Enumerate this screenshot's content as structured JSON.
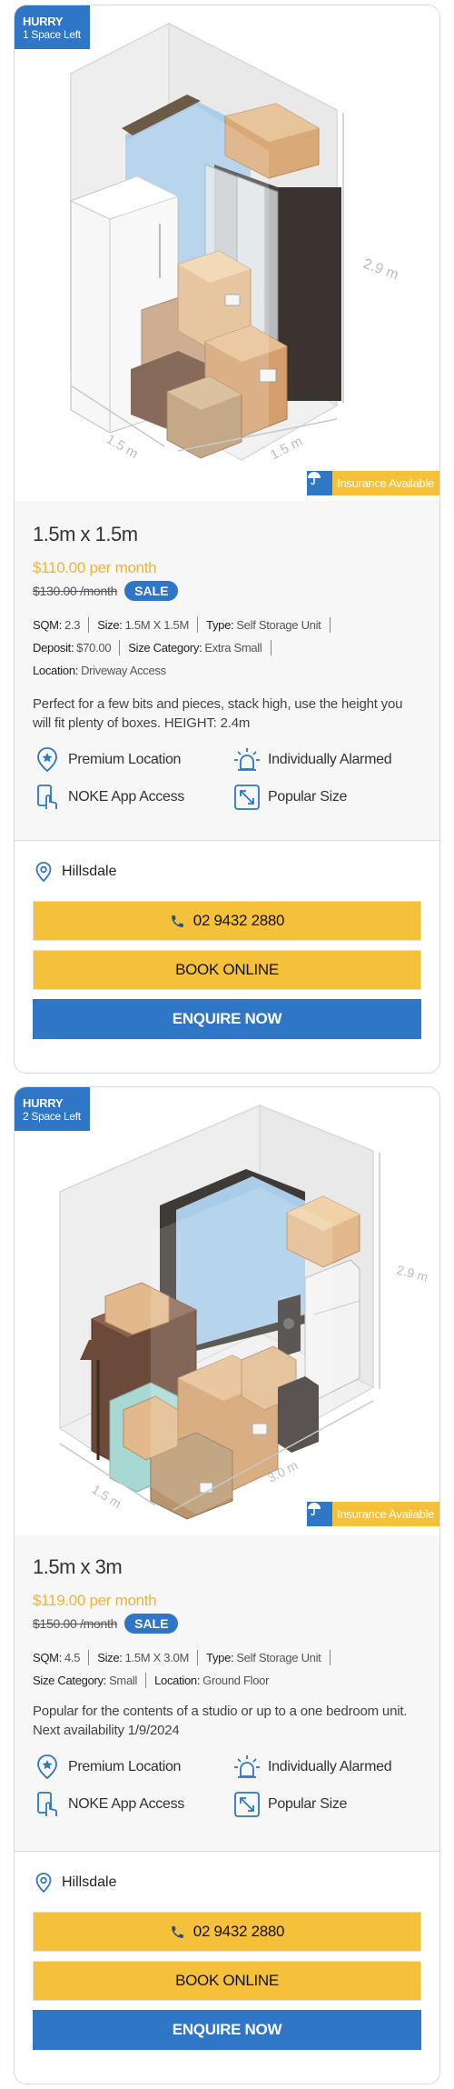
{
  "brand": {
    "colors": {
      "primary_blue": "#2f76c6",
      "accent_yellow": "#f5c13a",
      "price_orange": "#f2b431"
    }
  },
  "units": [
    {
      "hurry_title": "HURRY",
      "hurry_subtitle": "1 Space Left",
      "dim_side": "1.5 m",
      "dim_front": "1.5 m",
      "dim_height": "2.9 m",
      "insurance_label": "Insurance Available",
      "size_title": "1.5m x 1.5m",
      "price": "$110.00 per month",
      "was_price": "$130.00 /month",
      "sale_badge": "SALE",
      "specs": {
        "sqm_label": "SQM:",
        "sqm_value": "2.3",
        "size_label": "Size:",
        "size_value": "1.5M X 1.5M",
        "type_label": "Type:",
        "type_value": "Self Storage Unit",
        "deposit_label": "Deposit:",
        "deposit_value": "$70.00",
        "category_label": "Size Category:",
        "category_value": "Extra Small",
        "location_label": "Location:",
        "location_value": "Driveway Access"
      },
      "description": "Perfect for a few bits and pieces, stack high, use the height you will fit plenty of boxes. HEIGHT: 2.4m",
      "features": [
        "Premium Location",
        "Individually Alarmed",
        "NOKE App Access",
        "Popular Size"
      ],
      "location": "Hillsdale",
      "phone_button": "02 9432 2880",
      "book_button": "BOOK ONLINE",
      "enquire_button": "ENQUIRE NOW"
    },
    {
      "hurry_title": "HURRY",
      "hurry_subtitle": "2 Space Left",
      "dim_side": "1.5 m",
      "dim_front": "3.0 m",
      "dim_height": "2.9 m",
      "insurance_label": "Insurance Available",
      "size_title": "1.5m x 3m",
      "price": "$119.00 per month",
      "was_price": "$150.00 /month",
      "sale_badge": "SALE",
      "specs": {
        "sqm_label": "SQM:",
        "sqm_value": "4.5",
        "size_label": "Size:",
        "size_value": "1.5M X 3.0M",
        "type_label": "Type:",
        "type_value": "Self Storage Unit",
        "category_label": "Size Category:",
        "category_value": "Small",
        "location_label": "Location:",
        "location_value": "Ground Floor"
      },
      "description": "Popular for the contents of a studio or up to a one bedroom unit. Next availability 1/9/2024",
      "features": [
        "Premium Location",
        "Individually Alarmed",
        "NOKE App Access",
        "Popular Size"
      ],
      "location": "Hillsdale",
      "phone_button": "02 9432 2880",
      "book_button": "BOOK ONLINE",
      "enquire_button": "ENQUIRE NOW"
    }
  ]
}
